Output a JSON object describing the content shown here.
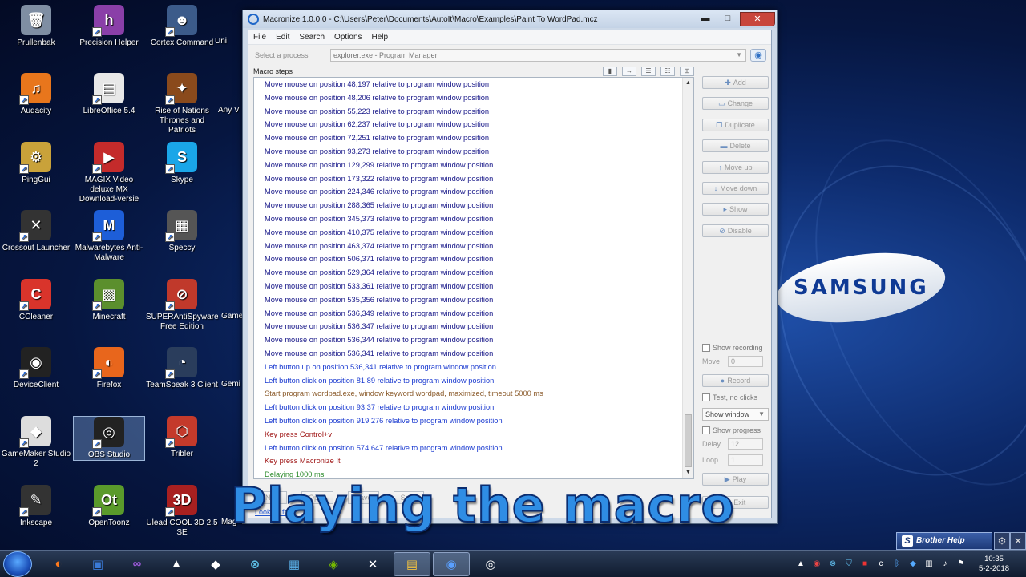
{
  "desktop": {
    "icons": [
      {
        "label": "Prullenbak",
        "glyph": "🗑",
        "color": "#7f8ea3"
      },
      {
        "label": "Precision Helper",
        "glyph": "h",
        "color": "#8a3fa8"
      },
      {
        "label": "Cortex Command",
        "glyph": "☻",
        "color": "#3c5b8a"
      },
      {
        "label": "Audacity",
        "glyph": "♫",
        "color": "#e8761c"
      },
      {
        "label": "LibreOffice 5.4",
        "glyph": "▤",
        "color": "#e8e8e8"
      },
      {
        "label": "Rise of Nations Thrones and Patriots",
        "glyph": "✦",
        "color": "#8a4a1c"
      },
      {
        "label": "PingGui",
        "glyph": "⚙",
        "color": "#c9a23a"
      },
      {
        "label": "MAGIX Video deluxe MX Download-versie",
        "glyph": "▶",
        "color": "#c42b2b"
      },
      {
        "label": "Skype",
        "glyph": "S",
        "color": "#1aa6e8"
      },
      {
        "label": "Crossout Launcher",
        "glyph": "✕",
        "color": "#333333"
      },
      {
        "label": "Malwarebytes Anti-Malware",
        "glyph": "M",
        "color": "#1d5ed8"
      },
      {
        "label": "Speccy",
        "glyph": "▦",
        "color": "#555555"
      },
      {
        "label": "CCleaner",
        "glyph": "C",
        "color": "#d9342b"
      },
      {
        "label": "Minecraft",
        "glyph": "▩",
        "color": "#5b8f2d"
      },
      {
        "label": "SUPERAntiSpyware Free Edition",
        "glyph": "⊘",
        "color": "#c0392b"
      },
      {
        "label": "DeviceClient",
        "glyph": "◉",
        "color": "#222222"
      },
      {
        "label": "Firefox",
        "glyph": "◐",
        "color": "#e8661c"
      },
      {
        "label": "TeamSpeak 3 Client",
        "glyph": "◔",
        "color": "#2a3d5c"
      },
      {
        "label": "GameMaker Studio 2",
        "glyph": "◆",
        "color": "#dddddd"
      },
      {
        "label": "OBS Studio",
        "glyph": "◎",
        "color": "#222222"
      },
      {
        "label": "Tribler",
        "glyph": "⬡",
        "color": "#c43a2b"
      },
      {
        "label": "Inkscape",
        "glyph": "✎",
        "color": "#333333"
      },
      {
        "label": "OpenToonz",
        "glyph": "Ot",
        "color": "#5a9a2b"
      },
      {
        "label": "Ulead COOL 3D 2.5 SE",
        "glyph": "3D",
        "color": "#a82020"
      }
    ],
    "partial": [
      "Uni",
      "Any V",
      "Game",
      "Gemi",
      "Mag"
    ]
  },
  "window": {
    "title": "Macronize 1.0.0.0 - C:\\Users\\Peter\\Documents\\AutoIt\\Macro\\Examples\\Paint To WordPad.mcz",
    "minimize": "▬",
    "maximize": "□",
    "close": "✕",
    "menu": [
      "File",
      "Edit",
      "Search",
      "Options",
      "Help"
    ],
    "process_label": "Select a process",
    "process_value": "explorer.exe - Program Manager",
    "steps_label": "Macro steps",
    "steps": [
      {
        "text": "Move mouse on position 48,197 relative to program window position",
        "color": "#1a1a8a"
      },
      {
        "text": "Move mouse on position 48,206 relative to program window position",
        "color": "#1a1a8a"
      },
      {
        "text": "Move mouse on position 55,223 relative to program window position",
        "color": "#1a1a8a"
      },
      {
        "text": "Move mouse on position 62,237 relative to program window position",
        "color": "#1a1a8a"
      },
      {
        "text": "Move mouse on position 72,251 relative to program window position",
        "color": "#1a1a8a"
      },
      {
        "text": "Move mouse on position 93,273 relative to program window position",
        "color": "#1a1a8a"
      },
      {
        "text": "Move mouse on position 129,299 relative to program window position",
        "color": "#1a1a8a"
      },
      {
        "text": "Move mouse on position 173,322 relative to program window position",
        "color": "#1a1a8a"
      },
      {
        "text": "Move mouse on position 224,346 relative to program window position",
        "color": "#1a1a8a"
      },
      {
        "text": "Move mouse on position 288,365 relative to program window position",
        "color": "#1a1a8a"
      },
      {
        "text": "Move mouse on position 345,373 relative to program window position",
        "color": "#1a1a8a"
      },
      {
        "text": "Move mouse on position 410,375 relative to program window position",
        "color": "#1a1a8a"
      },
      {
        "text": "Move mouse on position 463,374 relative to program window position",
        "color": "#1a1a8a"
      },
      {
        "text": "Move mouse on position 506,371 relative to program window position",
        "color": "#1a1a8a"
      },
      {
        "text": "Move mouse on position 529,364 relative to program window position",
        "color": "#1a1a8a"
      },
      {
        "text": "Move mouse on position 533,361 relative to program window position",
        "color": "#1a1a8a"
      },
      {
        "text": "Move mouse on position 535,356 relative to program window position",
        "color": "#1a1a8a"
      },
      {
        "text": "Move mouse on position 536,349 relative to program window position",
        "color": "#1a1a8a"
      },
      {
        "text": "Move mouse on position 536,347 relative to program window position",
        "color": "#1a1a8a"
      },
      {
        "text": "Move mouse on position 536,344 relative to program window position",
        "color": "#1a1a8a"
      },
      {
        "text": "Move mouse on position 536,341 relative to program window position",
        "color": "#1a1a8a"
      },
      {
        "text": "Left button up on position 536,341 relative to program window position",
        "color": "#1a3ad0"
      },
      {
        "text": "Left button click on position 81,89 relative to program window position",
        "color": "#1a3ad0"
      },
      {
        "text": "Start program wordpad.exe, window keyword wordpad, maximized, timeout 5000 ms",
        "color": "#8a5a2a"
      },
      {
        "text": "Left button click on position 93,37 relative to program window position",
        "color": "#1a3ad0"
      },
      {
        "text": "Left button click on position 919,276 relative to program window position",
        "color": "#1a3ad0"
      },
      {
        "text": "Key press Control+v",
        "color": "#a01818"
      },
      {
        "text": "Left button click on position 574,647 relative to program window position",
        "color": "#1a3ad0"
      },
      {
        "text": "Key press Macronize It",
        "color": "#a01818"
      },
      {
        "text": "Delaying 1000 ms",
        "color": "#2a8a2a"
      }
    ],
    "side_buttons": {
      "add": "Add",
      "change": "Change",
      "duplicate": "Duplicate",
      "delete": "Delete",
      "move_up": "Move up",
      "move_down": "Move down",
      "show": "Show",
      "disable": "Disable"
    },
    "show_recording": "Show recording",
    "move_label": "Move",
    "move_value": "0",
    "record": "Record",
    "test_no_clicks": "Test, no clicks",
    "show_window": "Show window",
    "show_progress": "Show progress",
    "delay_label": "Delay",
    "delay_value": "12",
    "loop_label": "Loop",
    "loop_value": "1",
    "play": "Play",
    "exit": "Exit",
    "bottom_buttons": [
      "New",
      "Open",
      "Save",
      "Save"
    ],
    "link": "Looking for"
  },
  "overlay_caption": "Playing the macro",
  "samsung_logo": "SAMSUNG",
  "brother_help": "Brother Help",
  "clock": {
    "time": "10:35",
    "date": "5-2-2018"
  }
}
